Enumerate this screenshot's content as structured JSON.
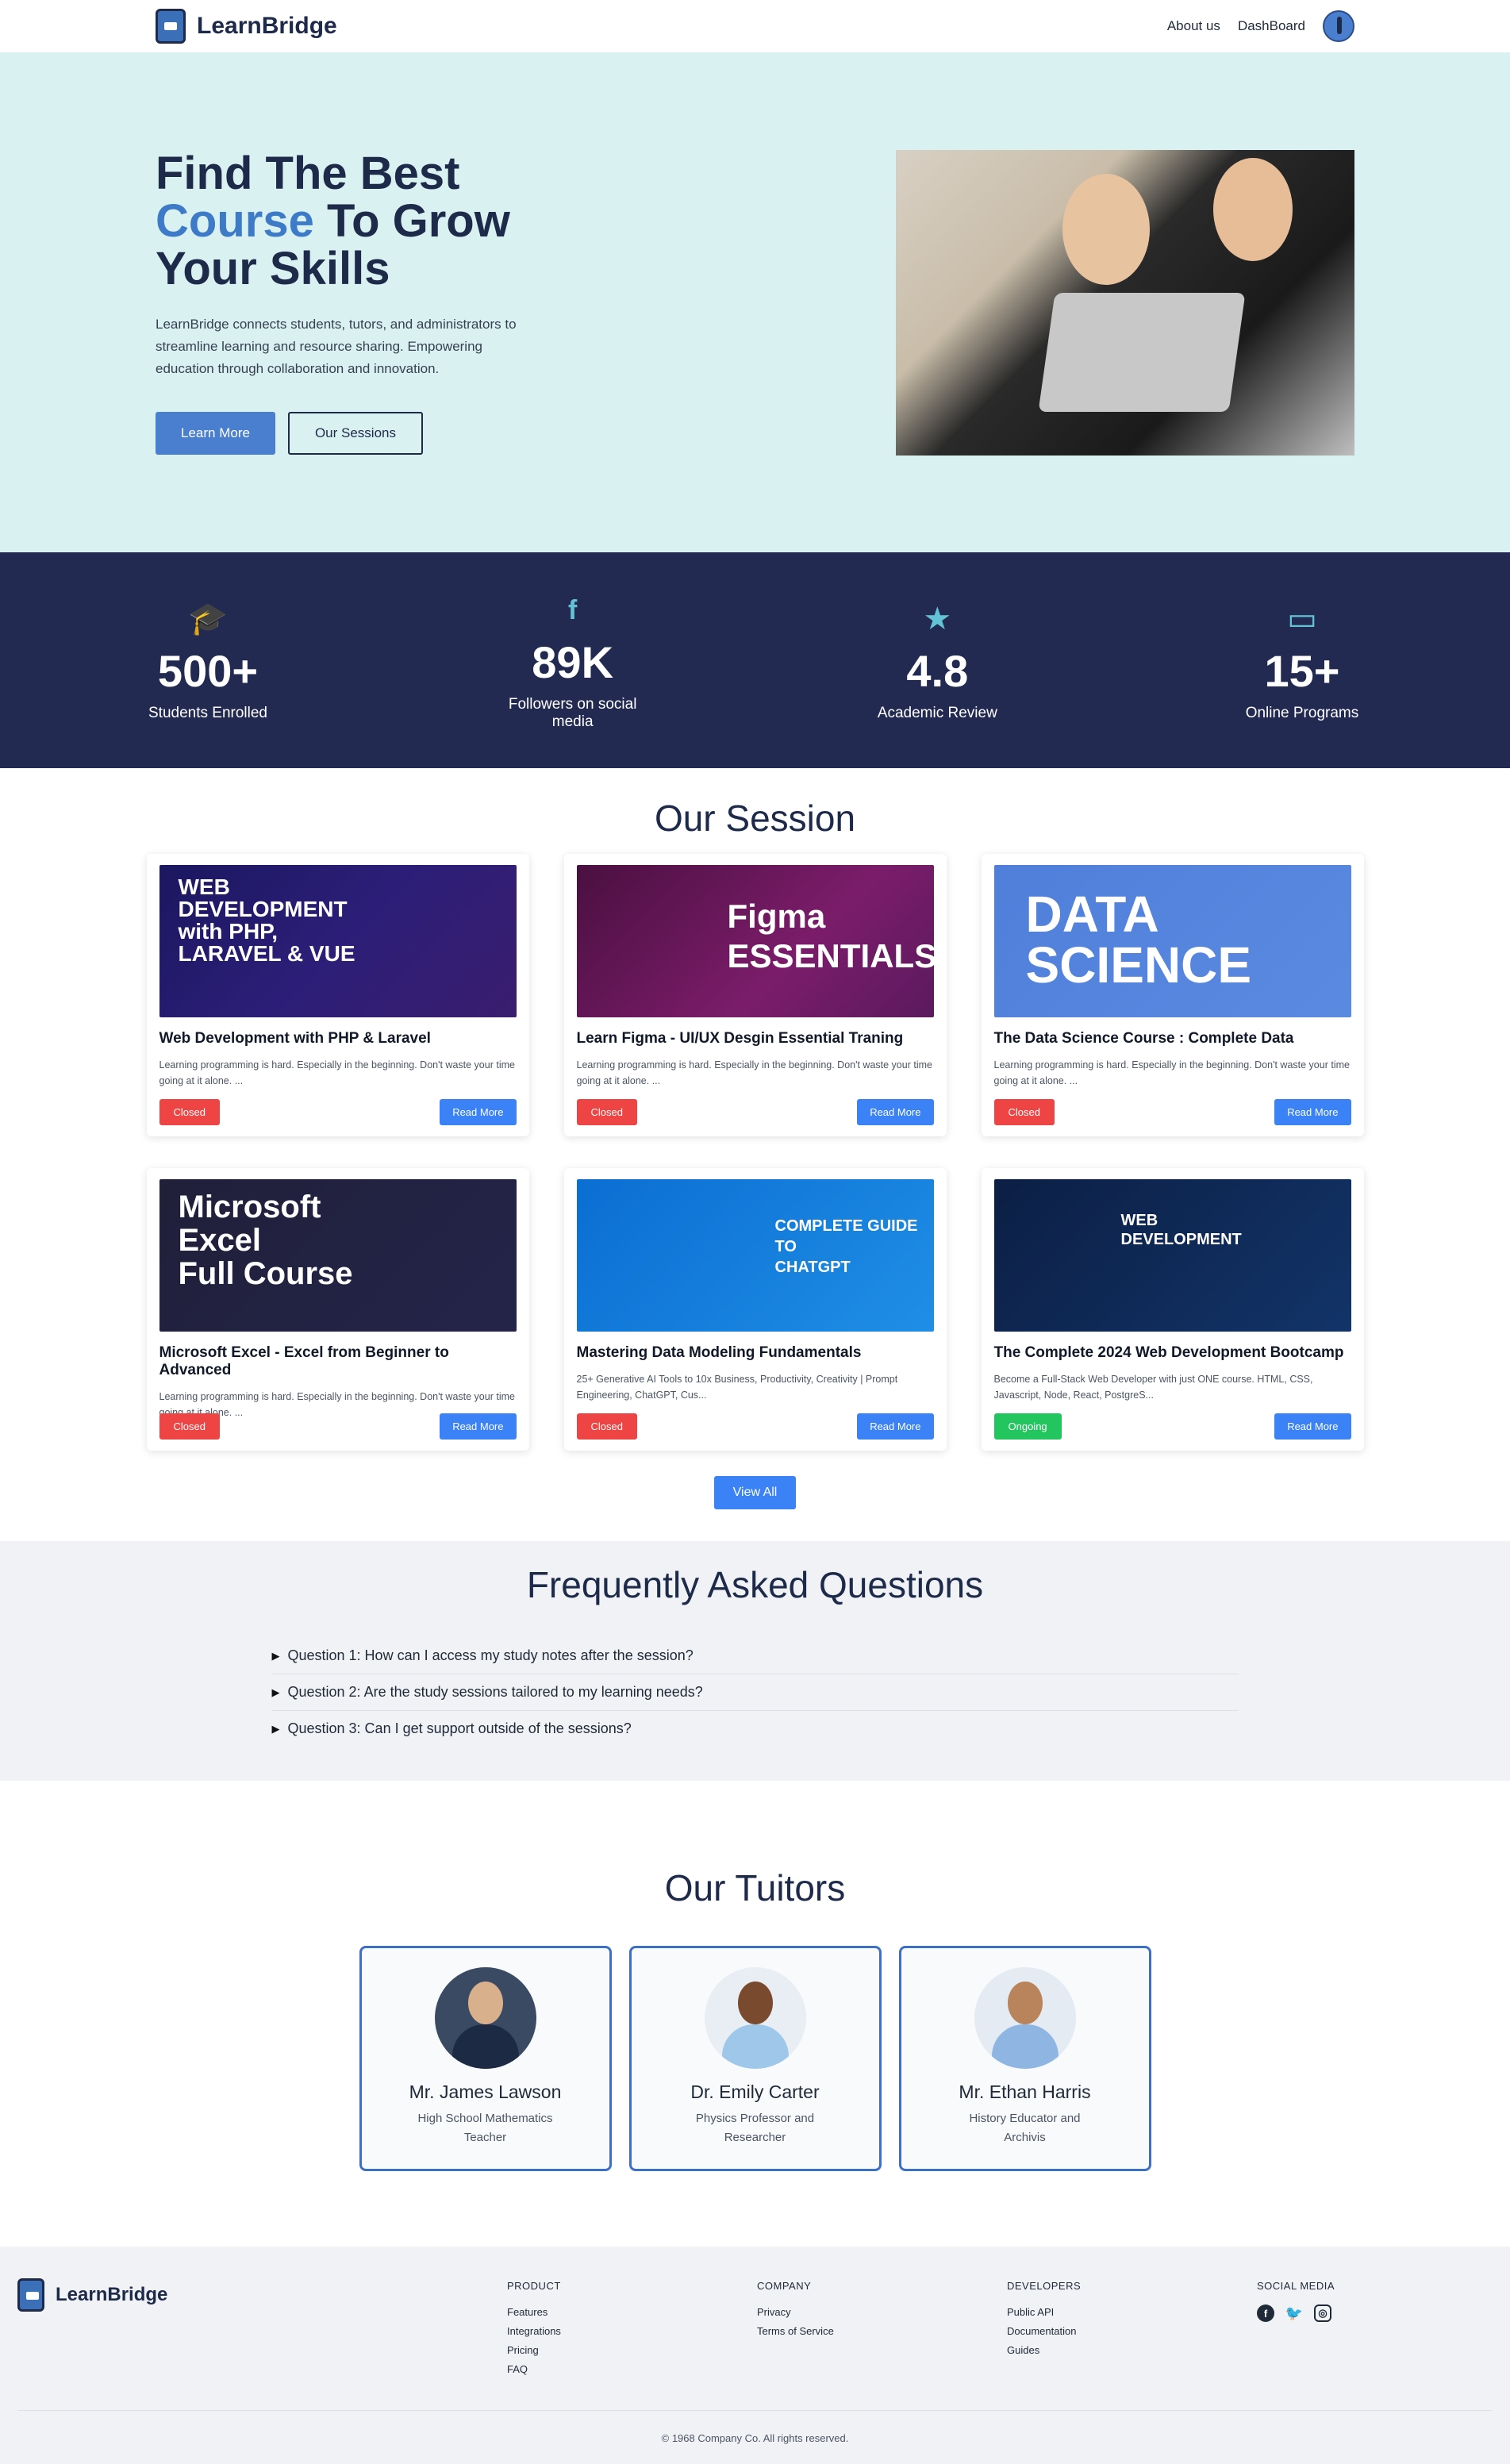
{
  "nav": {
    "brand": "LearnBridge",
    "links": [
      "About us",
      "DashBoard"
    ]
  },
  "hero": {
    "title_line1": "Find The Best",
    "title_accent": "Course",
    "title_line2_rest": " To Grow",
    "title_line3": "Your Skills",
    "description": "LearnBridge connects students, tutors, and administrators to streamline learning and resource sharing. Empowering education through collaboration and innovation.",
    "primary_button": "Learn More",
    "secondary_button": "Our Sessions"
  },
  "stats": [
    {
      "icon": "graduation-cap-icon",
      "value": "500+",
      "label": "Students Enrolled"
    },
    {
      "icon": "facebook-icon",
      "value": "89K",
      "label": "Followers on social media"
    },
    {
      "icon": "star-icon",
      "value": "4.8",
      "label": "Academic Review"
    },
    {
      "icon": "chalkboard-teacher-icon",
      "value": "15+",
      "label": "Online Programs"
    }
  ],
  "sessions": {
    "title": "Our Session",
    "cards": [
      {
        "image_text": "WEB\nDEVELOPMENT\nwith PHP,\nLARAVEL & VUE",
        "title": "Web Development with PHP & Laravel",
        "desc": "Learning programming is hard. Especially in the beginning. Don't waste your time going at it alone. ...",
        "status": "Closed",
        "read": "Read More"
      },
      {
        "image_text": "Figma\nESSENTIALS",
        "title": "Learn Figma - UI/UX Desgin Essential Traning",
        "desc": "Learning programming is hard. Especially in the beginning. Don't waste your time going at it alone. ...",
        "status": "Closed",
        "read": "Read More"
      },
      {
        "image_text": "DATA\nSCIENCE",
        "title": "The Data Science Course : Complete Data",
        "desc": "Learning programming is hard. Especially in the beginning. Don't waste your time going at it alone. ...",
        "status": "Closed",
        "read": "Read More"
      },
      {
        "image_text": "Microsoft\nExcel\nFull Course",
        "title": "Microsoft Excel - Excel from Beginner to Advanced",
        "desc": "Learning programming is hard. Especially in the beginning. Don't waste your time going at it alone. ...",
        "status": "Closed",
        "read": "Read More"
      },
      {
        "image_text": "COMPLETE GUIDE TO\nCHATGPT",
        "title": "Mastering Data Modeling Fundamentals",
        "desc": "25+ Generative AI Tools to 10x Business, Productivity, Creativity | Prompt Engineering, ChatGPT, Cus...",
        "status": "Closed",
        "read": "Read More"
      },
      {
        "image_text": "WEB\nDEVELOPMENT",
        "title": "The Complete 2024 Web Development Bootcamp",
        "desc": "Become a Full-Stack Web Developer with just ONE course. HTML, CSS, Javascript, Node, React, PostgreS...",
        "status": "Ongoing",
        "read": "Read More"
      }
    ],
    "view_all": "View All"
  },
  "faq": {
    "title": "Frequently Asked Questions",
    "items": [
      "Question 1: How can I access my study notes after the session?",
      "Question 2: Are the study sessions tailored to my learning needs?",
      "Question 3: Can I get support outside of the sessions?"
    ]
  },
  "tutors": {
    "title": "Our Tuitors",
    "items": [
      {
        "name": "Mr. James Lawson",
        "role": "High School Mathematics Teacher"
      },
      {
        "name": "Dr. Emily Carter",
        "role": "Physics Professor and Researcher"
      },
      {
        "name": "Mr. Ethan Harris",
        "role": "History Educator and Archivis"
      }
    ]
  },
  "footer": {
    "brand": "LearnBridge",
    "columns": [
      {
        "head": "PRODUCT",
        "links": [
          "Features",
          "Integrations",
          "Pricing",
          "FAQ"
        ]
      },
      {
        "head": "COMPANY",
        "links": [
          "Privacy",
          "Terms of Service"
        ]
      },
      {
        "head": "DEVELOPERS",
        "links": [
          "Public API",
          "Documentation",
          "Guides"
        ]
      }
    ],
    "social_head": "SOCIAL MEDIA",
    "social_icons": [
      "facebook-icon",
      "twitter-icon",
      "instagram-icon"
    ],
    "copyright": "© 1968 Company Co. All rights reserved."
  },
  "colors": {
    "brand_dark": "#1e2a4a",
    "accent": "#3d7ac7",
    "hero_bg": "#daf1f1",
    "stats_bg": "#232a52",
    "closed": "#ef4444",
    "ongoing": "#22c55e",
    "button_blue": "#3b82f6"
  }
}
